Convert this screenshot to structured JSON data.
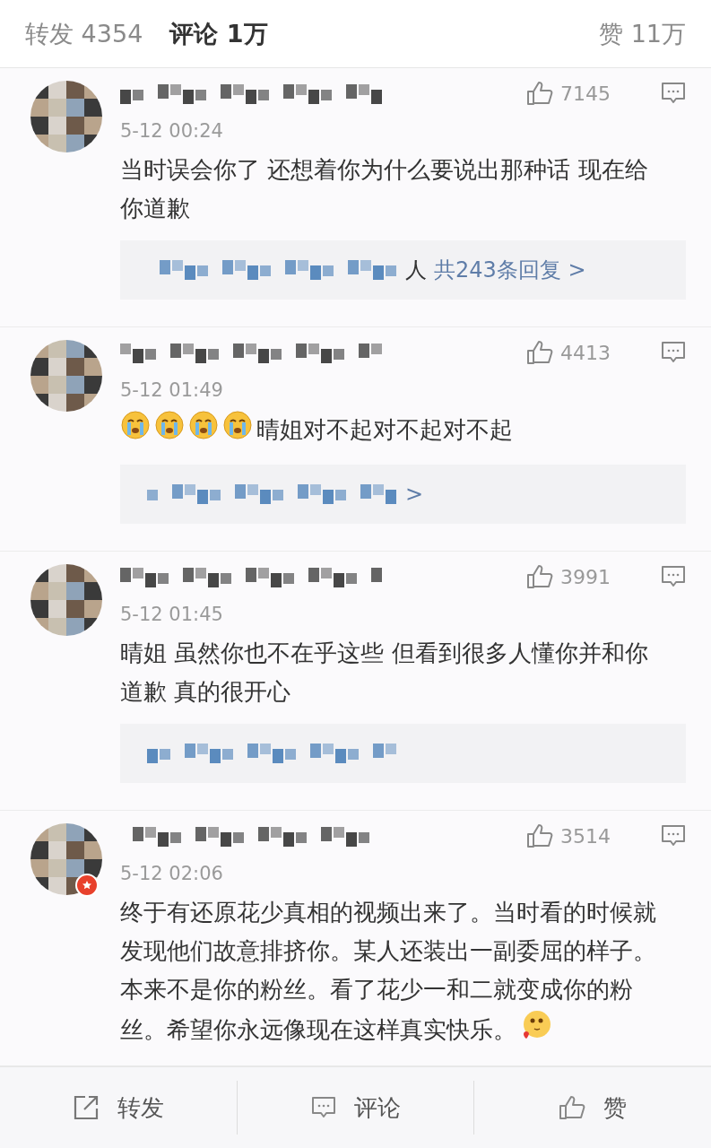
{
  "header": {
    "tabs": [
      {
        "label": "转发",
        "count": "4354",
        "selected": false
      },
      {
        "label": "评论",
        "count": "1万",
        "selected": true
      }
    ],
    "likes": {
      "label": "赞",
      "count": "11万"
    }
  },
  "comments": [
    {
      "date": "5-12 00:24",
      "likes": "7145",
      "text": "当时误会你了  还想着你为什么要说出那种话 现在给你道歉",
      "reply_preview": {
        "blurred": true,
        "text": "人",
        "link": "共243条回复 >"
      }
    },
    {
      "date": "5-12 01:49",
      "likes": "4413",
      "emojis": [
        {
          "kind": "crying"
        },
        {
          "kind": "crying"
        },
        {
          "kind": "crying"
        },
        {
          "kind": "crying"
        }
      ],
      "text": "晴姐对不起对不起对不起",
      "reply_preview": {
        "blurred": true,
        "link": ">"
      }
    },
    {
      "date": "5-12 01:45",
      "likes": "3991",
      "text": "晴姐 虽然你也不在乎这些 但看到很多人懂你并和你道歉 真的很开心",
      "reply_preview": {
        "blurred": true
      }
    },
    {
      "date": "5-12 02:06",
      "likes": "3514",
      "verified": true,
      "text": "终于有还原花少真相的视频出来了。当时看的时候就发现他们故意排挤你。某人还装出一副委屈的样子。本来不是你的粉丝。看了花少一和二就变成你的粉丝。希望你永远像现在这样真实快乐。",
      "trailing_emoji": {
        "kind": "blushing"
      }
    }
  ],
  "actions": [
    {
      "kind": "share",
      "label": "转发"
    },
    {
      "kind": "comment",
      "label": "评论"
    },
    {
      "kind": "like",
      "label": "赞"
    }
  ]
}
